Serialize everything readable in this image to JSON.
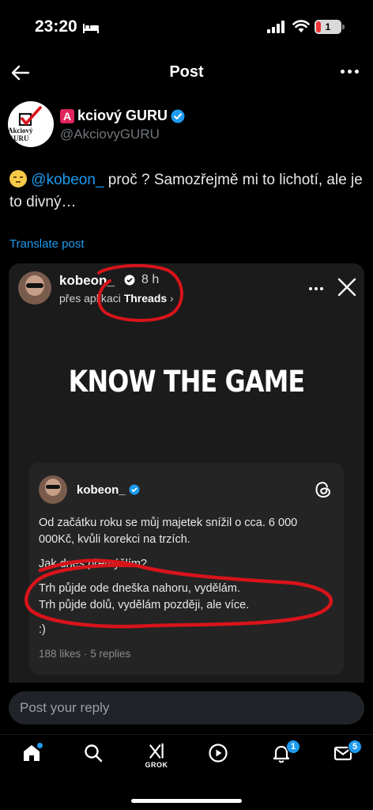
{
  "status_bar": {
    "time": "23:20",
    "battery_level": "1"
  },
  "header": {
    "title": "Post"
  },
  "author": {
    "name": "kciový GURU",
    "name_prefix_letter": "A",
    "handle": "@AkciovyGURU",
    "avatar_logo_text": "Akciový GURU"
  },
  "post": {
    "mention": "@kobeon_",
    "text_after_mention": " proč ? Samozřejmě mi to lichotí, ale je to divný…",
    "translate_label": "Translate post"
  },
  "media": {
    "username": "kobeon_",
    "time_ago": "8 h",
    "via_text": "přes aplikaci ",
    "via_app": "Threads",
    "headline": "KNOW THE GAME",
    "card": {
      "username": "kobeon_",
      "para1": "Od začátku roku se můj majetek snížil o cca. 6 000 000Kč, kvůli korekci na trzích.",
      "para2": "Jak dnes přemýšlím?",
      "para3_line1": "Trh půjde ode dneška nahoru, vydělám.",
      "para3_line2": "Trh půjde dolů, vydělám později, ale více.",
      "para4": ":)",
      "stats": "188 likes · 5 replies"
    }
  },
  "reply": {
    "placeholder": "Post your reply"
  },
  "tabbar": {
    "grok_label": "GROK",
    "notifications_count": "1",
    "messages_count": "5"
  },
  "colors": {
    "accent": "#1d9bf0",
    "annotation_red": "#d8141a",
    "background": "#000000"
  }
}
